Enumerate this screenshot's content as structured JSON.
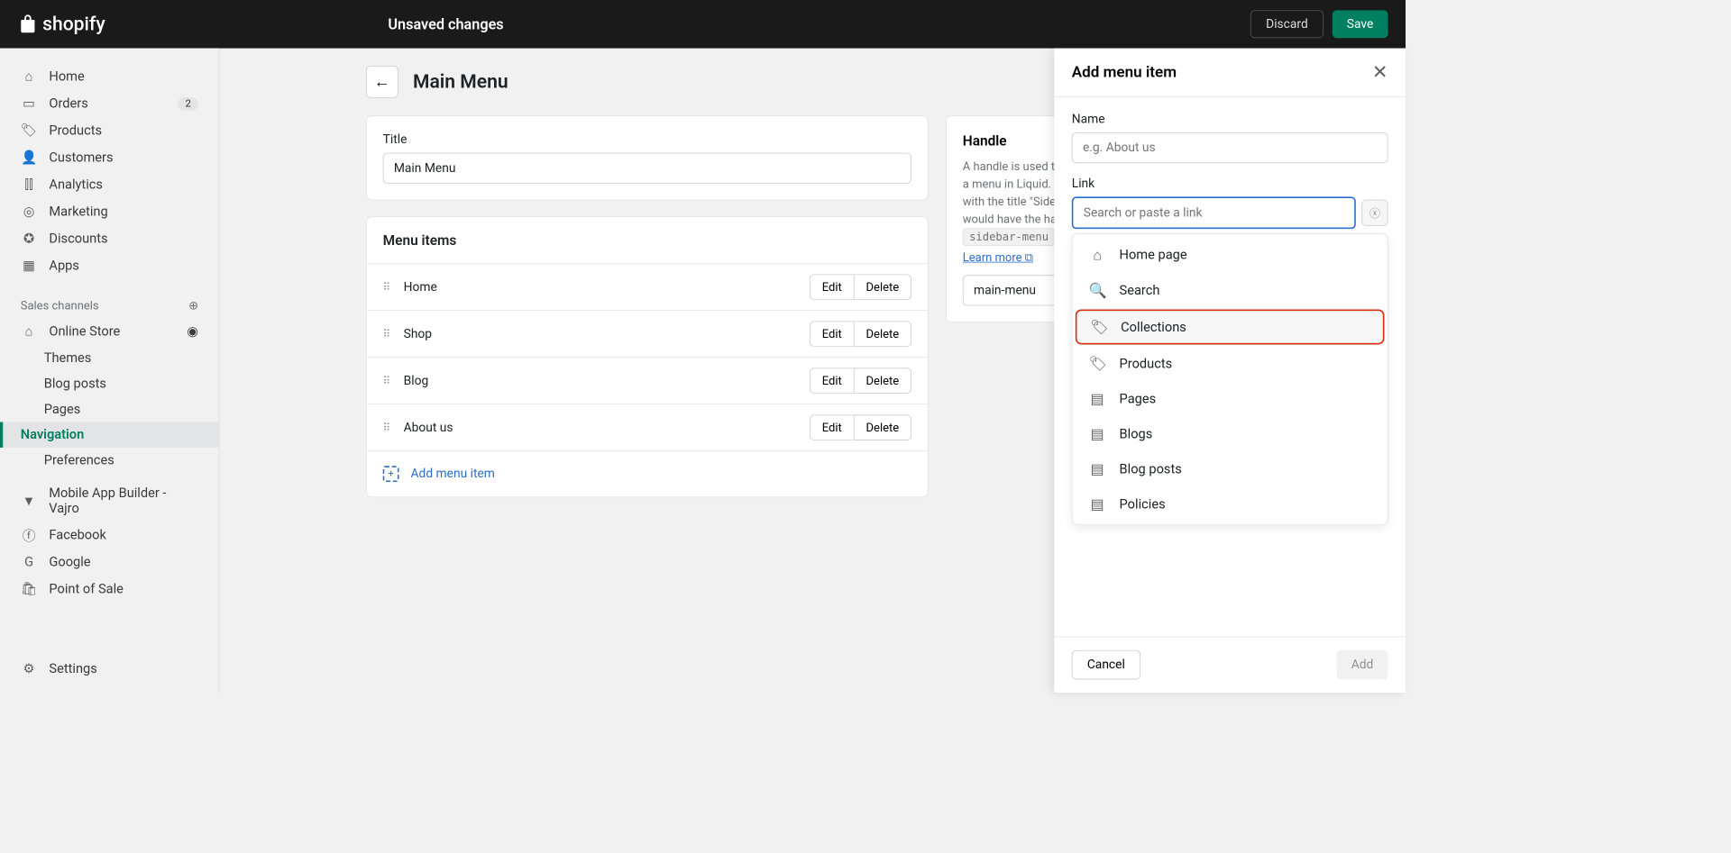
{
  "topbar": {
    "brand": "shopify",
    "status": "Unsaved changes",
    "discard": "Discard",
    "save": "Save"
  },
  "sidebar": {
    "items": [
      {
        "label": "Home"
      },
      {
        "label": "Orders",
        "badge": "2"
      },
      {
        "label": "Products"
      },
      {
        "label": "Customers"
      },
      {
        "label": "Analytics"
      },
      {
        "label": "Marketing"
      },
      {
        "label": "Discounts"
      },
      {
        "label": "Apps"
      }
    ],
    "channels_label": "Sales channels",
    "online_store": "Online Store",
    "store_sub": [
      {
        "label": "Themes"
      },
      {
        "label": "Blog posts"
      },
      {
        "label": "Pages"
      },
      {
        "label": "Navigation"
      },
      {
        "label": "Preferences"
      }
    ],
    "extra": [
      {
        "label": "Mobile App Builder - Vajro"
      },
      {
        "label": "Facebook"
      },
      {
        "label": "Google"
      },
      {
        "label": "Point of Sale"
      }
    ],
    "settings": "Settings"
  },
  "page": {
    "title": "Main Menu",
    "title_field_label": "Title",
    "title_field_value": "Main Menu",
    "menu_items_label": "Menu items",
    "menu_items": [
      {
        "name": "Home"
      },
      {
        "name": "Shop"
      },
      {
        "name": "Blog"
      },
      {
        "name": "About us"
      }
    ],
    "edit": "Edit",
    "delete": "Delete",
    "add_menu_item": "Add menu item",
    "handle": {
      "title": "Handle",
      "text1": "A handle is used to reference a menu in Liquid. e.g. a menu with the title \"Sidebar menu\" would have the handle",
      "code": "sidebar-menu",
      "learn": "Learn more",
      "value": "main-menu"
    }
  },
  "drawer": {
    "title": "Add menu item",
    "name_label": "Name",
    "name_placeholder": "e.g. About us",
    "link_label": "Link",
    "link_placeholder": "Search or paste a link",
    "options": [
      {
        "label": "Home page"
      },
      {
        "label": "Search"
      },
      {
        "label": "Collections"
      },
      {
        "label": "Products"
      },
      {
        "label": "Pages"
      },
      {
        "label": "Blogs"
      },
      {
        "label": "Blog posts"
      },
      {
        "label": "Policies"
      }
    ],
    "cancel": "Cancel",
    "add": "Add"
  }
}
